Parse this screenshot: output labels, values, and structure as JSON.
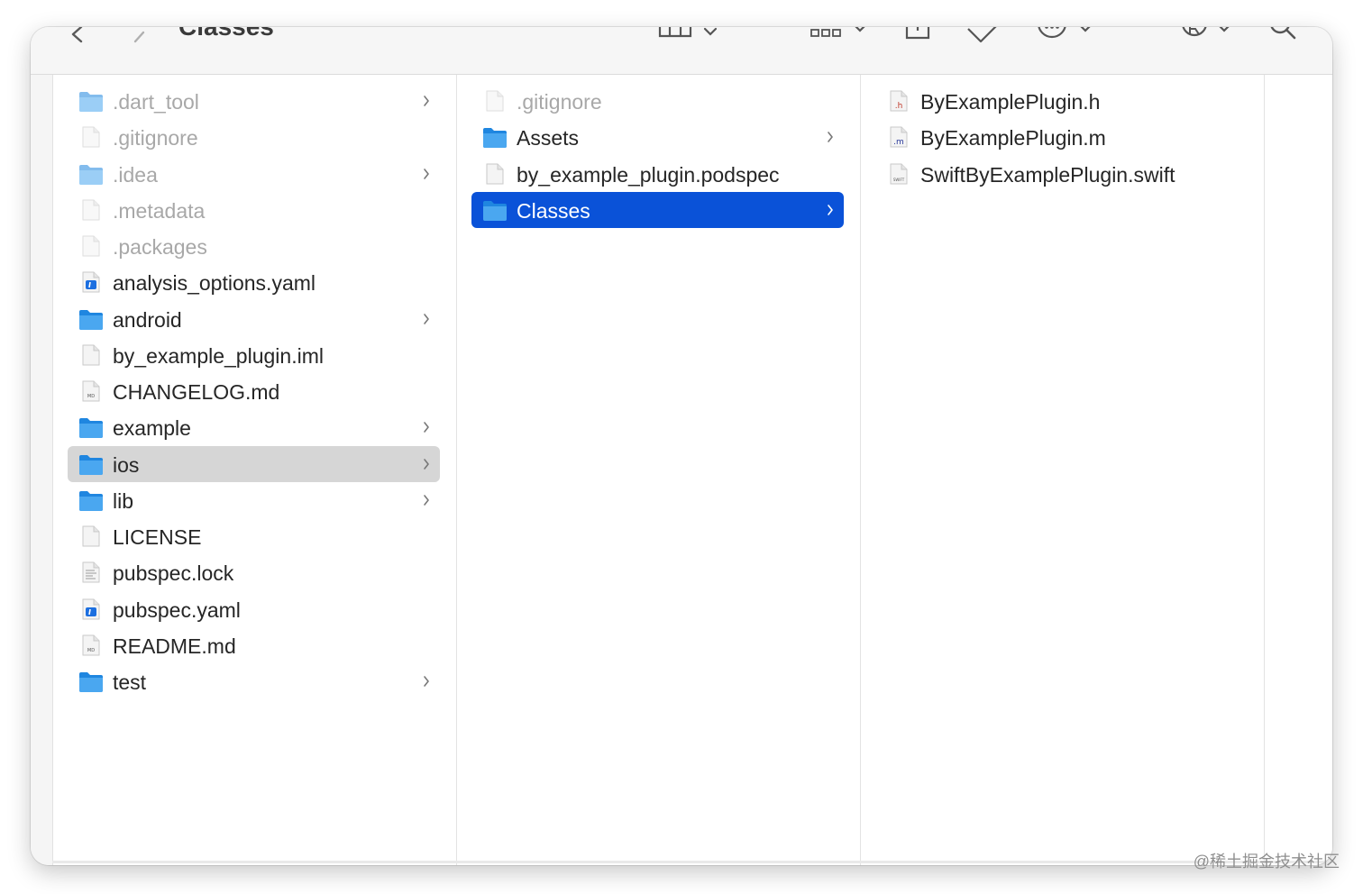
{
  "window": {
    "title": "Classes"
  },
  "toolbar": {
    "back_icon": "chevron-left-icon",
    "forward_icon": "chevron-right-icon",
    "view_icon": "columns-view-icon",
    "group_icon": "group-grid-icon",
    "share_icon": "share-icon",
    "tag_icon": "tag-icon",
    "action_icon": "more-actions-icon",
    "extra_icon": "registered-icon",
    "search_icon": "search-icon"
  },
  "columns": [
    {
      "items": [
        {
          "name": ".dart_tool",
          "kind": "folder",
          "dim": true,
          "has_children": true
        },
        {
          "name": ".gitignore",
          "kind": "file-blank",
          "dim": true,
          "has_children": false
        },
        {
          "name": ".idea",
          "kind": "folder",
          "dim": true,
          "has_children": true
        },
        {
          "name": ".metadata",
          "kind": "file-blank",
          "dim": true,
          "has_children": false
        },
        {
          "name": ".packages",
          "kind": "file-blank",
          "dim": true,
          "has_children": false
        },
        {
          "name": "analysis_options.yaml",
          "kind": "file-yaml",
          "dim": false,
          "has_children": false
        },
        {
          "name": "android",
          "kind": "folder",
          "dim": false,
          "has_children": true
        },
        {
          "name": "by_example_plugin.iml",
          "kind": "file-blank",
          "dim": false,
          "has_children": false
        },
        {
          "name": "CHANGELOG.md",
          "kind": "file-md",
          "dim": false,
          "has_children": false
        },
        {
          "name": "example",
          "kind": "folder",
          "dim": false,
          "has_children": true
        },
        {
          "name": "ios",
          "kind": "folder",
          "dim": false,
          "has_children": true,
          "selected": "inactive"
        },
        {
          "name": "lib",
          "kind": "folder",
          "dim": false,
          "has_children": true
        },
        {
          "name": "LICENSE",
          "kind": "file-blank",
          "dim": false,
          "has_children": false
        },
        {
          "name": "pubspec.lock",
          "kind": "file-text",
          "dim": false,
          "has_children": false
        },
        {
          "name": "pubspec.yaml",
          "kind": "file-yaml",
          "dim": false,
          "has_children": false
        },
        {
          "name": "README.md",
          "kind": "file-md",
          "dim": false,
          "has_children": false
        },
        {
          "name": "test",
          "kind": "folder",
          "dim": false,
          "has_children": true
        }
      ]
    },
    {
      "items": [
        {
          "name": ".gitignore",
          "kind": "file-blank",
          "dim": true,
          "has_children": false
        },
        {
          "name": "Assets",
          "kind": "folder",
          "dim": false,
          "has_children": true
        },
        {
          "name": "by_example_plugin.podspec",
          "kind": "file-blank",
          "dim": false,
          "has_children": false
        },
        {
          "name": "Classes",
          "kind": "folder",
          "dim": false,
          "has_children": true,
          "selected": "active"
        }
      ]
    },
    {
      "items": [
        {
          "name": "ByExamplePlugin.h",
          "kind": "file-h",
          "dim": false,
          "has_children": false
        },
        {
          "name": "ByExamplePlugin.m",
          "kind": "file-m",
          "dim": false,
          "has_children": false
        },
        {
          "name": "SwiftByExamplePlugin.swift",
          "kind": "file-swift",
          "dim": false,
          "has_children": false
        }
      ]
    },
    {
      "items": []
    }
  ],
  "watermark": "@稀土掘金技术社区",
  "colors": {
    "selection_active": "#0a52d8",
    "selection_inactive": "#d6d6d6",
    "folder": "#3d9be9"
  }
}
